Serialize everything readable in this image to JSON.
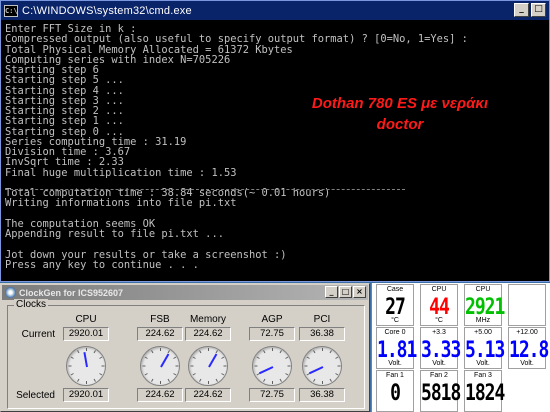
{
  "cmd": {
    "title": "C:\\WINDOWS\\system32\\cmd.exe",
    "icon_label": "C:\\",
    "lines": [
      "Enter FFT Size in k :",
      "Compressed output (also useful to specify output format) ? [0=No, 1=Yes] :",
      "Total Physical Memory Allocated = 61372 Kbytes",
      "Computing series with index N=705226",
      "Starting step 6",
      "Starting step 5 ...",
      "Starting step 4 ...",
      "Starting step 3 ...",
      "Starting step 2 ...",
      "Starting step 1 ...",
      "Starting step 0 ...",
      "Series computing time : 31.19",
      "Division time : 3.67",
      "InvSqrt time : 2.33",
      "Final huge multiplication time : 1.53",
      "",
      "Total computation time : 38.84 seconds(~ 0.01 hours)",
      "Writing informations into file pi.txt",
      "",
      "The computation seems OK",
      "Appending result to file pi.txt ...",
      "",
      "Jot down your results or take a screenshot :)",
      "Press any key to continue . . ."
    ],
    "overlay_line1": "Dothan 780 ES με νεράκι",
    "overlay_line2": "doctor",
    "overlay_color": "#ff1a1a"
  },
  "clockgen": {
    "title": "ClockGen for ICS952607",
    "group_label": "Clocks",
    "row_current": "Current",
    "row_selected": "Selected",
    "columns": [
      {
        "name": "CPU",
        "current": "2920.01",
        "selected": "2920.01",
        "needle_deg": -10
      },
      {
        "name": "FSB",
        "current": "224.62",
        "selected": "224.62",
        "needle_deg": 30
      },
      {
        "name": "Memory",
        "current": "224.62",
        "selected": "224.62",
        "needle_deg": 30
      },
      {
        "name": "AGP",
        "current": "72.75",
        "selected": "72.75",
        "needle_deg": -115
      },
      {
        "name": "PCI",
        "current": "36.38",
        "selected": "36.38",
        "needle_deg": -115
      }
    ]
  },
  "sensors": {
    "cells": [
      {
        "label": "Case",
        "value": "27",
        "unit": "°C",
        "color": "#000000"
      },
      {
        "label": "CPU",
        "value": "44",
        "unit": "°C",
        "color": "#ff0000"
      },
      {
        "label": "CPU",
        "value": "2921",
        "unit": "MHz",
        "color": "#00c000"
      },
      {
        "label": "",
        "value": "",
        "unit": "",
        "color": "#000000"
      },
      {
        "label": "Core 0",
        "value": "1.81",
        "unit": "Volt.",
        "color": "#0000ff"
      },
      {
        "label": "+3.3",
        "value": "3.33",
        "unit": "Volt.",
        "color": "#0000ff"
      },
      {
        "label": "+5.00",
        "value": "5.13",
        "unit": "Volt.",
        "color": "#0000ff"
      },
      {
        "label": "+12.00",
        "value": "12.8",
        "unit": "Volt.",
        "color": "#0000ff"
      },
      {
        "label": "Fan 1",
        "value": "0",
        "unit": "",
        "color": "#000000"
      },
      {
        "label": "Fan 2",
        "value": "5818",
        "unit": "",
        "color": "#000000"
      },
      {
        "label": "Fan 3",
        "value": "1824",
        "unit": "",
        "color": "#000000"
      }
    ]
  }
}
